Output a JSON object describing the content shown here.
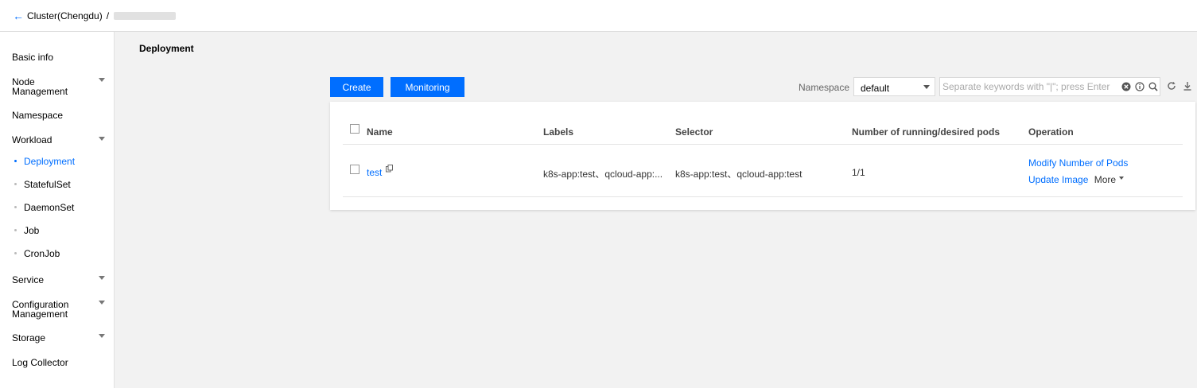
{
  "breadcrumb": {
    "cluster": "Cluster(Chengdu)",
    "separator": "/"
  },
  "sidebar": {
    "items": [
      {
        "label": "Basic info"
      },
      {
        "label": "Node Management"
      },
      {
        "label": "Namespace"
      },
      {
        "label": "Workload"
      },
      {
        "label": "Service"
      },
      {
        "label": "Configuration Management"
      },
      {
        "label": "Storage"
      },
      {
        "label": "Log Collector"
      }
    ],
    "workload_sub": [
      {
        "label": "Deployment",
        "active": true
      },
      {
        "label": "StatefulSet"
      },
      {
        "label": "DaemonSet"
      },
      {
        "label": "Job"
      },
      {
        "label": "CronJob"
      }
    ]
  },
  "page": {
    "title": "Deployment"
  },
  "toolbar": {
    "create_label": "Create",
    "monitoring_label": "Monitoring",
    "namespace_label": "Namespace",
    "namespace_value": "default",
    "search_placeholder": "Separate keywords with \"|\"; press Enter"
  },
  "table": {
    "columns": [
      "Name",
      "Labels",
      "Selector",
      "Number of running/desired pods",
      "Operation"
    ],
    "rows": [
      {
        "name": "test",
        "labels": "k8s-app:test、qcloud-app:...",
        "selector": "k8s-app:test、qcloud-app:test",
        "pods": "1/1",
        "ops": {
          "modify": "Modify Number of Pods",
          "update": "Update Image",
          "more": "More"
        }
      }
    ]
  },
  "colors": {
    "accent": "#006eff",
    "background": "#f2f2f2"
  },
  "icons": [
    "back-arrow-icon",
    "clear-icon",
    "info-icon",
    "search-icon",
    "refresh-icon",
    "download-icon",
    "copy-icon"
  ]
}
